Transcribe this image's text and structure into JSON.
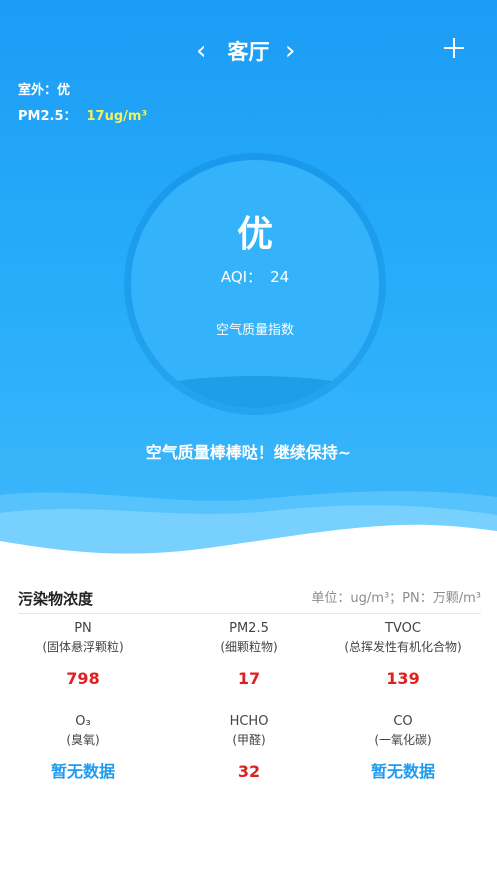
{
  "header": {
    "room_name": "客厅",
    "prev_icon": "chevron-left-icon",
    "next_icon": "chevron-right-icon",
    "add_icon": "plus-icon"
  },
  "outdoor": {
    "quality_label": "室外：优",
    "pm25_label": "PM2.5：",
    "pm25_value": "17ug/m³"
  },
  "gauge": {
    "level": "优",
    "aqi_label": "AQI：",
    "aqi_value": "24",
    "caption": "空气质量指数"
  },
  "slogan": "空气质量棒棒哒！继续保持~",
  "pollutants": {
    "title": "污染物浓度",
    "unit_note": "单位：ug/m³；PN：万颗/m³",
    "items": [
      {
        "name": "PN",
        "desc": "(固体悬浮颗粒)",
        "value": "798",
        "status": "red"
      },
      {
        "name": "PM2.5",
        "desc": "(细颗粒物)",
        "value": "17",
        "status": "red"
      },
      {
        "name": "TVOC",
        "desc": "(总挥发性有机化合物)",
        "value": "139",
        "status": "red"
      },
      {
        "name": "O₃",
        "desc": "(臭氧)",
        "value": "暂无数据",
        "status": "blue"
      },
      {
        "name": "HCHO",
        "desc": "(甲醛)",
        "value": "32",
        "status": "red"
      },
      {
        "name": "CO",
        "desc": "(一氧化碳)",
        "value": "暂无数据",
        "status": "blue"
      }
    ]
  },
  "colors": {
    "hero_top": "#1c9cf6",
    "hero_bottom": "#3fb8fb",
    "value_red": "#e02020",
    "value_blue": "#1e9cf0",
    "outdoor_pm_value": "#f3f35a"
  }
}
